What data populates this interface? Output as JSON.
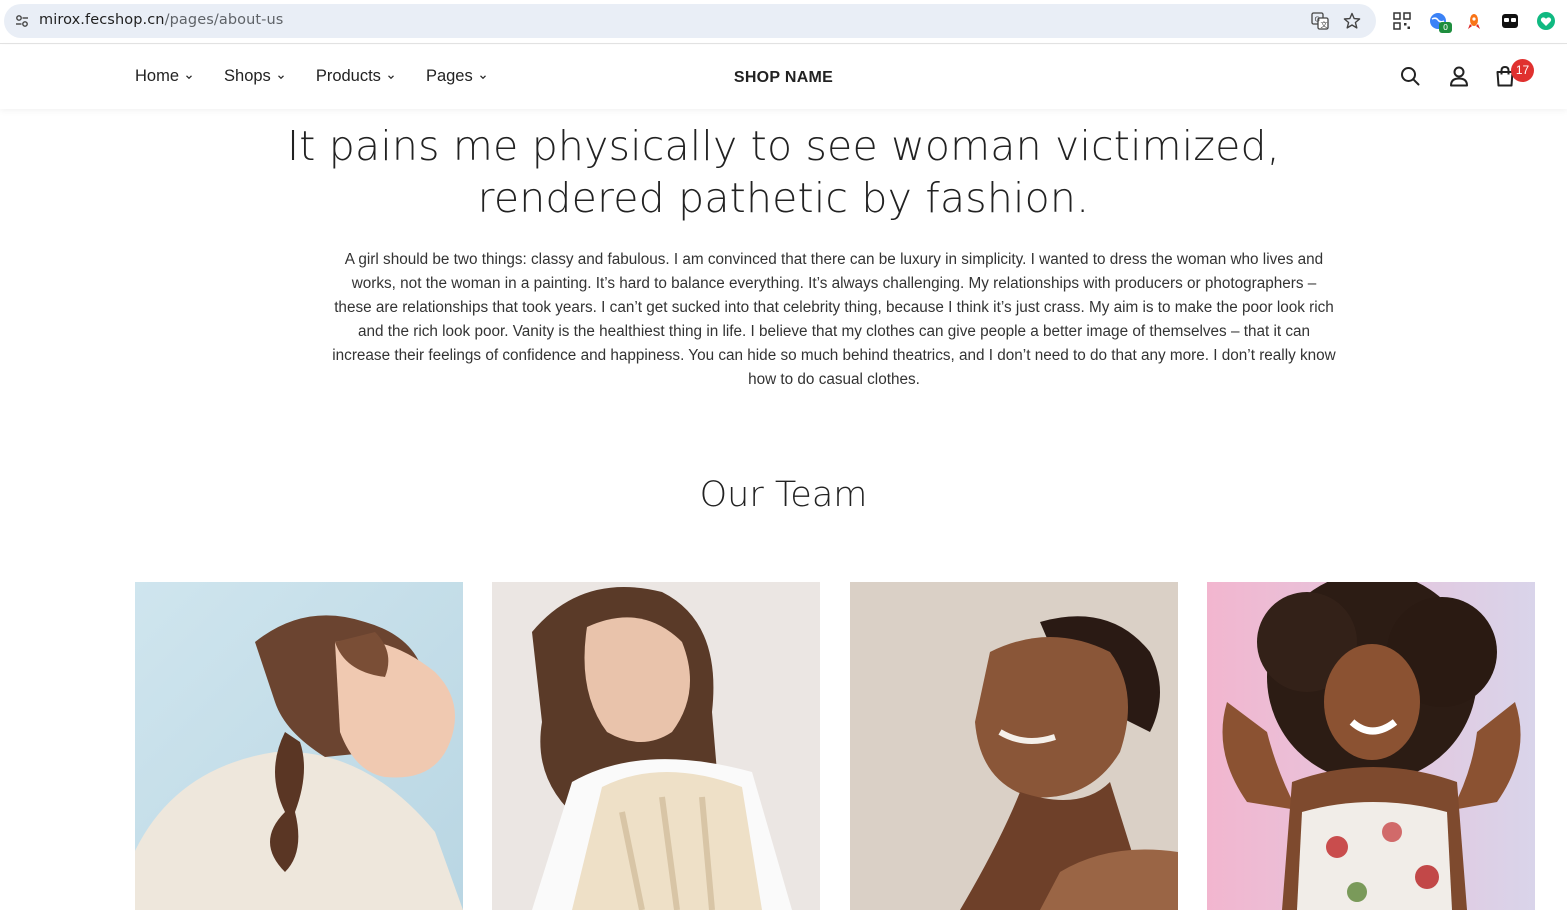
{
  "browser": {
    "url_host": "mirox.fecshop.cn",
    "url_path": "/pages/about-us",
    "extension_badge": "0"
  },
  "header": {
    "nav": [
      {
        "label": "Home"
      },
      {
        "label": "Shops"
      },
      {
        "label": "Products"
      },
      {
        "label": "Pages"
      }
    ],
    "brand": "SHOP NAME",
    "cart_count": "17"
  },
  "hero": {
    "title_line1": "It pains me physically to see woman victimized,",
    "title_line2": "rendered pathetic by fashion.",
    "body": "A girl should be two things: classy and fabulous. I am convinced that there can be luxury in simplicity. I wanted to dress the woman who lives and works, not the woman in a painting. It’s hard to balance everything. It’s always challenging. My relationships with producers or photographers – these are relationships that took years. I can’t get sucked into that celebrity thing, because I think it’s just crass. My aim is to make the poor look rich and the rich look poor. Vanity is the healthiest thing in life. I believe that my clothes can give people a better image of themselves – that it can increase their feelings of confidence and happiness. You can hide so much behind theatrics, and I don’t need to do that any more. I don’t really know how to do casual clothes."
  },
  "team": {
    "title": "Our Team",
    "members": [
      {
        "photo": "woman-ponytail-profile",
        "bg": "#c9e0ea"
      },
      {
        "photo": "woman-knit-vest",
        "bg": "#ece8e5"
      },
      {
        "photo": "woman-short-hair-smiling",
        "bg": "#d9cfc5"
      },
      {
        "photo": "woman-curly-hair-dancing",
        "bg": "#e9c6dc"
      }
    ]
  },
  "colors": {
    "omnibox": "#e9eef6",
    "badge": "#e0312f",
    "text": "#222222"
  }
}
